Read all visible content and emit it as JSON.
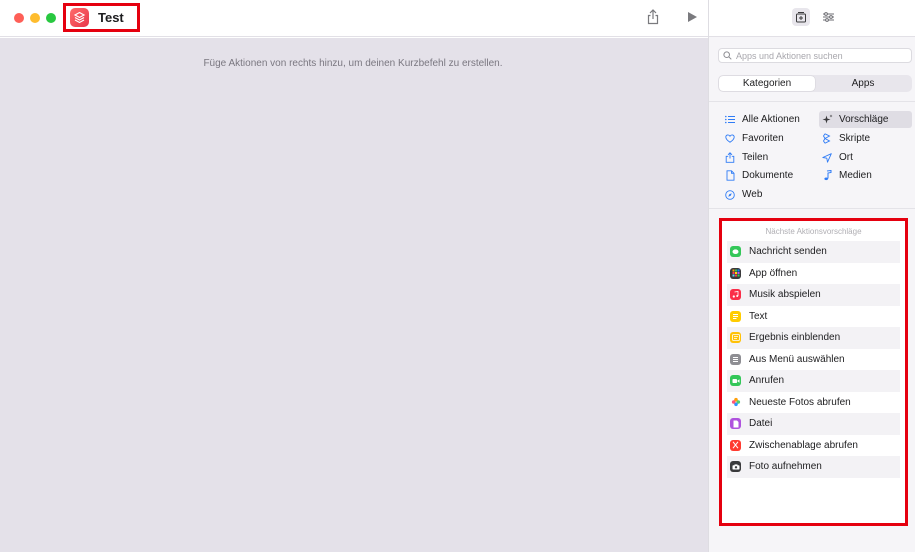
{
  "window": {
    "title": "Test"
  },
  "editor": {
    "hint": "Füge Aktionen von rechts hinzu, um deinen Kurzbefehl zu erstellen."
  },
  "sidebar": {
    "search_placeholder": "Apps und Aktionen suchen",
    "segments": [
      "Kategorien",
      "Apps"
    ],
    "active_segment": "Kategorien",
    "categories": [
      {
        "label": "Alle Aktionen",
        "icon": "list-icon"
      },
      {
        "label": "Vorschläge",
        "icon": "sparkles-icon",
        "selected": true
      },
      {
        "label": "Favoriten",
        "icon": "heart-icon"
      },
      {
        "label": "Skripte",
        "icon": "scripts-icon"
      },
      {
        "label": "Teilen",
        "icon": "share-icon"
      },
      {
        "label": "Ort",
        "icon": "location-arrow-icon"
      },
      {
        "label": "Dokumente",
        "icon": "document-icon"
      },
      {
        "label": "Medien",
        "icon": "music-note-icon"
      },
      {
        "label": "Web",
        "icon": "compass-icon"
      }
    ],
    "suggestions_heading": "Nächste Aktionsvorschläge",
    "suggestions": [
      {
        "label": "Nachricht senden",
        "icon": "messages-icon",
        "color": "#34c759"
      },
      {
        "label": "App öffnen",
        "icon": "app-grid-icon",
        "color": "#3a3a3c"
      },
      {
        "label": "Musik abspielen",
        "icon": "music-icon",
        "color": "#fa2d48"
      },
      {
        "label": "Text",
        "icon": "text-icon",
        "color": "#ffcc00"
      },
      {
        "label": "Ergebnis einblenden",
        "icon": "result-icon",
        "color": "#ffc107"
      },
      {
        "label": "Aus Menü auswählen",
        "icon": "menu-icon",
        "color": "#8e8e93"
      },
      {
        "label": "Anrufen",
        "icon": "facetime-icon",
        "color": "#34c759"
      },
      {
        "label": "Neueste Fotos abrufen",
        "icon": "photos-icon",
        "color": "#ff9f0a"
      },
      {
        "label": "Datei",
        "icon": "file-icon",
        "color": "#af52de"
      },
      {
        "label": "Zwischenablage abrufen",
        "icon": "clipboard-icon",
        "color": "#ff3b30"
      },
      {
        "label": "Foto aufnehmen",
        "icon": "camera-icon",
        "color": "#3a3a3c"
      }
    ]
  }
}
